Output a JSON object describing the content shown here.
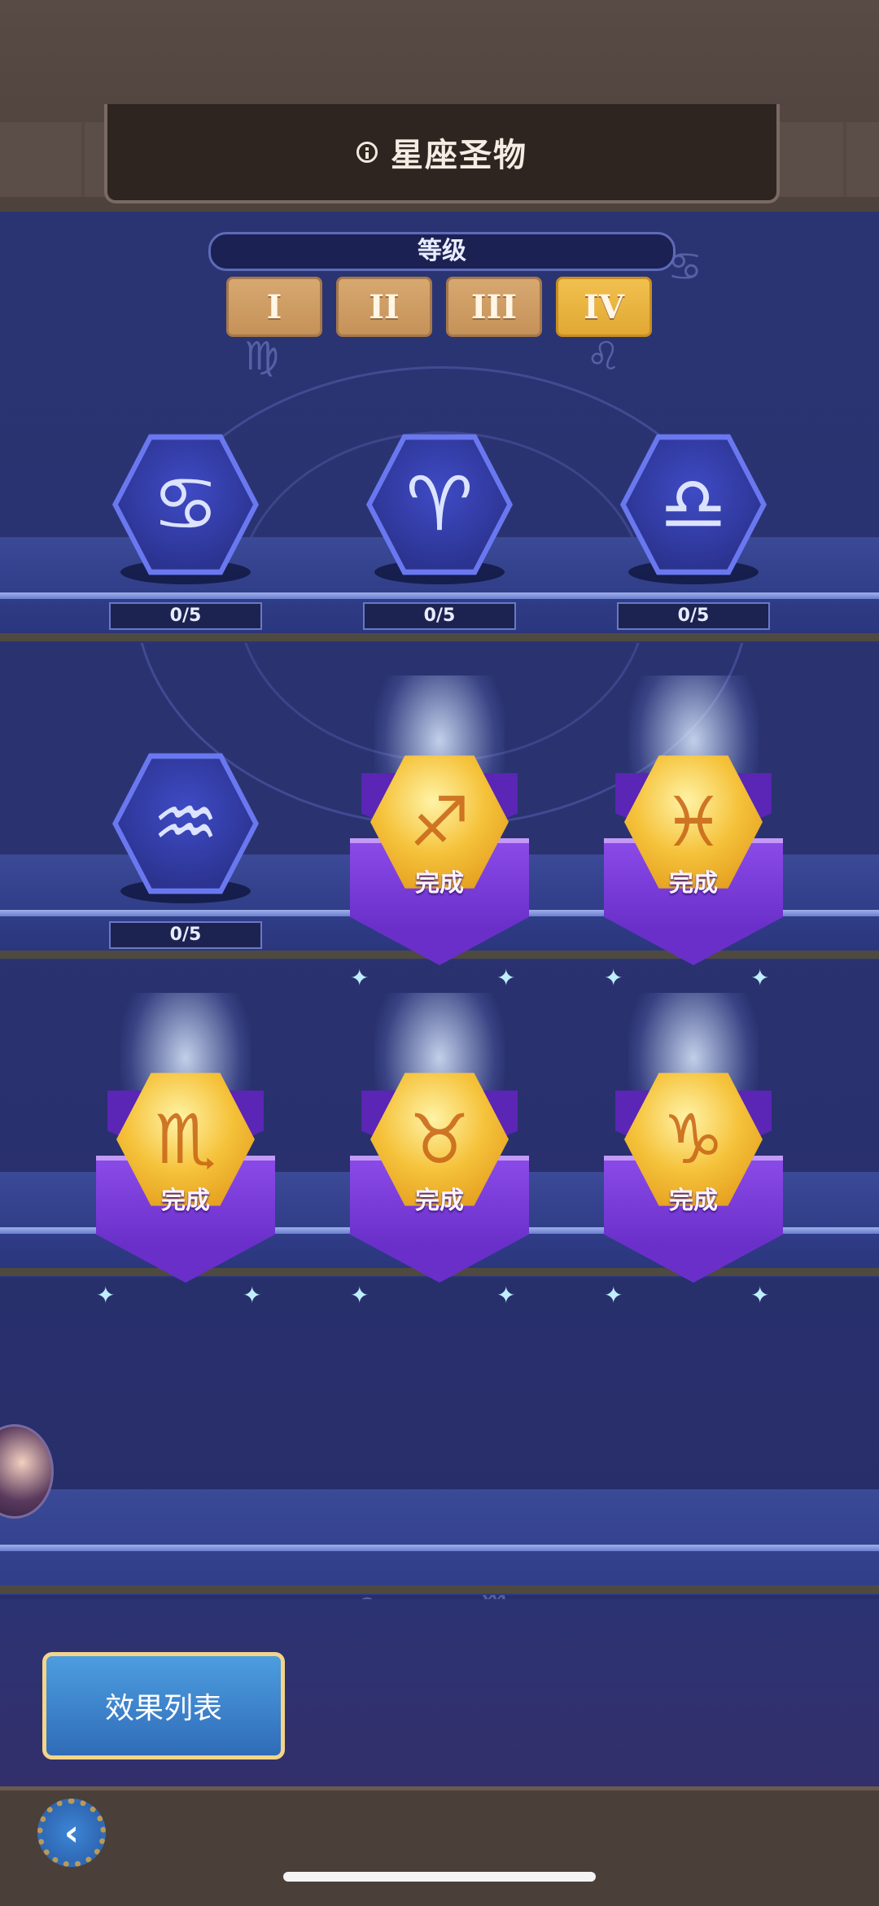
{
  "header": {
    "title": "星座圣物",
    "info_icon": "info-icon"
  },
  "levels": {
    "label": "等级",
    "tabs": [
      "I",
      "II",
      "III",
      "IV"
    ],
    "selected": "IV"
  },
  "relics": [
    {
      "symbol": "♋",
      "progress": "0/5",
      "status": "locked"
    },
    {
      "symbol": "♈",
      "progress": "0/5",
      "status": "locked"
    },
    {
      "symbol": "♎",
      "progress": "0/5",
      "status": "locked"
    },
    {
      "symbol": "♒",
      "progress": "0/5",
      "status": "locked"
    },
    {
      "symbol": "♐",
      "status_label": "完成",
      "status": "done"
    },
    {
      "symbol": "♓",
      "status_label": "完成",
      "status": "done"
    },
    {
      "symbol": "♏",
      "status_label": "完成",
      "status": "done"
    },
    {
      "symbol": "♉",
      "status_label": "完成",
      "status": "done"
    },
    {
      "symbol": "♑",
      "status_label": "完成",
      "status": "done"
    }
  ],
  "effects_button": "效果列表",
  "back_button": "‹",
  "colors": {
    "accent_gold": "#e1a833",
    "panel_blue": "#2b3472",
    "banner_purple": "#6a2fc9"
  }
}
